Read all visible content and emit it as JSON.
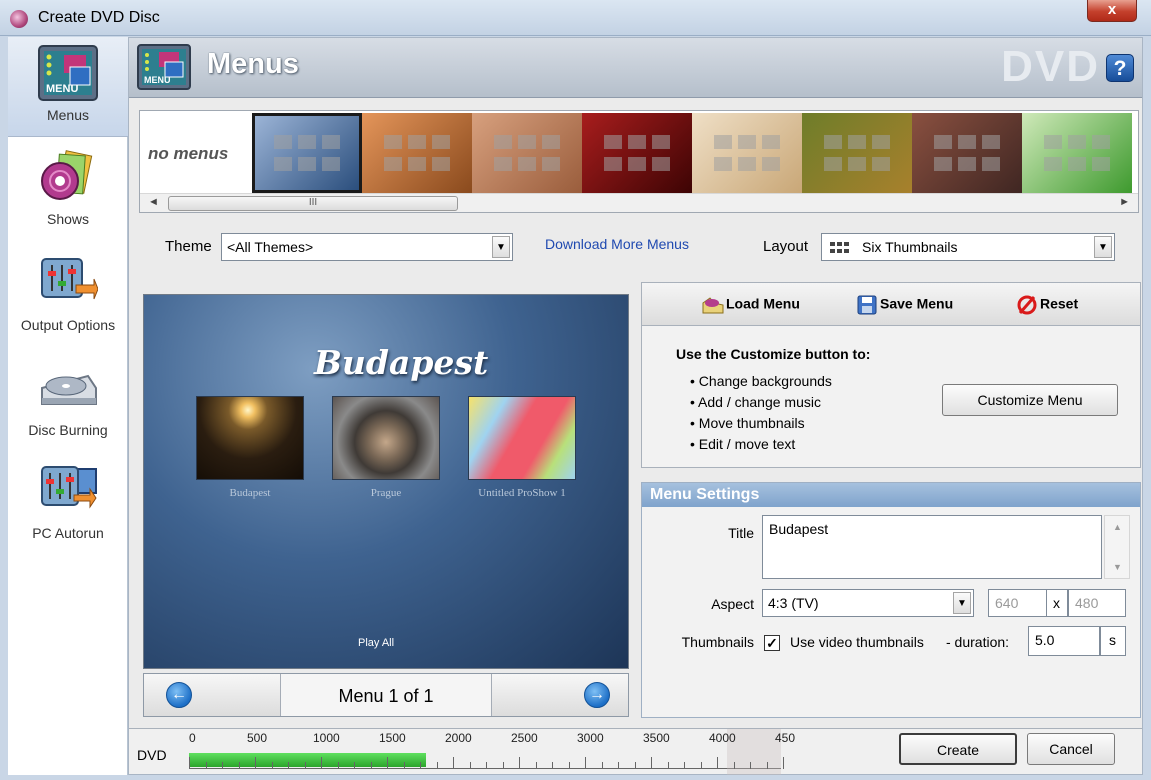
{
  "window": {
    "title": "Create DVD Disc",
    "close_label": "x"
  },
  "sidebar": {
    "items": [
      {
        "label": "Menus",
        "icon": "menus-icon",
        "active": true
      },
      {
        "label": "Shows",
        "icon": "shows-icon",
        "active": false
      },
      {
        "label": "Output Options",
        "icon": "output-options-icon",
        "active": false
      },
      {
        "label": "Disc Burning",
        "icon": "disc-burning-icon",
        "active": false
      },
      {
        "label": "PC Autorun",
        "icon": "pc-autorun-icon",
        "active": false
      }
    ]
  },
  "header": {
    "title": "Menus",
    "watermark": "DVD",
    "help_label": "?"
  },
  "theme_strip": {
    "no_menus_label": "no menus",
    "thumbnails": [
      {
        "name": "blue-parchment",
        "colors": [
          "#9fb7d9",
          "#274b7a"
        ],
        "selected": true
      },
      {
        "name": "orange-leaves",
        "colors": [
          "#e4955a",
          "#8a4a1d"
        ],
        "selected": false
      },
      {
        "name": "rust-texture",
        "colors": [
          "#d7a07e",
          "#9a5d3c"
        ],
        "selected": false
      },
      {
        "name": "red-curtain",
        "colors": [
          "#a81d1d",
          "#3d0404"
        ],
        "selected": false
      },
      {
        "name": "ivory-flower",
        "colors": [
          "#efdfc6",
          "#c9a777"
        ],
        "selected": false
      },
      {
        "name": "garden-food",
        "colors": [
          "#6e7d2a",
          "#a8802c"
        ],
        "selected": false
      },
      {
        "name": "dark-leaves",
        "colors": [
          "#8a5040",
          "#3f2622"
        ],
        "selected": false
      },
      {
        "name": "green-leaf",
        "colors": [
          "#cfe9b9",
          "#3e9a2e"
        ],
        "selected": false
      }
    ],
    "scroll_grip": "III",
    "scroll_left": "◄",
    "scroll_right": "►"
  },
  "theme_row": {
    "theme_label": "Theme",
    "theme_value": "<All Themes>",
    "download_link": "Download More Menus",
    "layout_label": "Layout",
    "layout_value": "Six Thumbnails",
    "dropdown_glyph": "▼"
  },
  "preview": {
    "menu_title": "Budapest",
    "thumbnails": [
      {
        "caption": "Budapest"
      },
      {
        "caption": "Prague"
      },
      {
        "caption": "Untitled ProShow 1"
      }
    ],
    "play_all": "Play All",
    "page_label": "Menu 1 of 1",
    "prev_glyph": "←",
    "next_glyph": "→"
  },
  "toolbar": {
    "load_label": "Load Menu",
    "save_label": "Save Menu",
    "reset_label": "Reset"
  },
  "customize": {
    "heading": "Use the Customize button to:",
    "bullets": [
      "• Change backgrounds",
      "• Add / change music",
      "• Move thumbnails",
      "• Edit / move text"
    ],
    "button_label": "Customize Menu"
  },
  "menu_settings": {
    "header": "Menu Settings",
    "title_label": "Title",
    "title_value": "Budapest",
    "aspect_label": "Aspect",
    "aspect_value": "4:3 (TV)",
    "width_value": "640",
    "x_label": "x",
    "height_value": "480",
    "thumbnails_label": "Thumbnails",
    "use_video_checked": true,
    "check_glyph": "✓",
    "use_video_label": "Use video thumbnails",
    "duration_label": "- duration:",
    "duration_value": "5.0",
    "duration_unit": "s"
  },
  "bottom": {
    "disc_label": "DVD",
    "ruler_labels": [
      "0",
      "500",
      "1000",
      "1500",
      "2000",
      "2500",
      "3000",
      "3500",
      "4000",
      "450"
    ],
    "used_fraction": 0.4,
    "create_label": "Create",
    "cancel_label": "Cancel"
  }
}
